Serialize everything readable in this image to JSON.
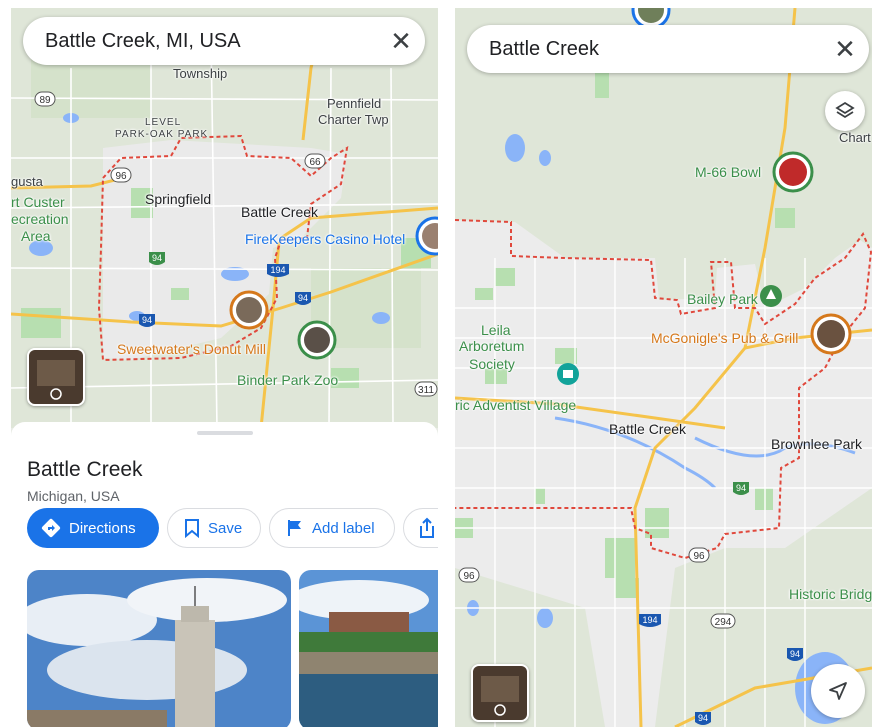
{
  "left": {
    "search": {
      "text": "Battle Creek, MI, USA",
      "clear_icon": "close-icon"
    },
    "map_labels": {
      "township": "Township",
      "level": "LEVEL",
      "park_oak_park": "PARK-OAK PARK",
      "pennfield": "Pennfield",
      "charter_twp": "Charter Twp",
      "gusta": "gusta",
      "fort_custer": "rt Custer",
      "recreation": "ecreation",
      "area": "Area",
      "springfield": "Springfield",
      "battle_creek": "Battle Creek",
      "firekeepers": "FireKeepers Casino Hotel",
      "sweetwater": "Sweetwater's Donut Mill",
      "binder_park": "Binder Park Zoo"
    },
    "route_shields": [
      "89",
      "96",
      "66",
      "94",
      "194",
      "94",
      "94",
      "311"
    ],
    "place": {
      "title": "Battle Creek",
      "subtitle": "Michigan, USA",
      "actions": {
        "directions": "Directions",
        "save": "Save",
        "add_label": "Add label"
      }
    }
  },
  "right": {
    "search": {
      "text": "Battle Creek",
      "clear_icon": "close-icon"
    },
    "map_labels": {
      "m66_bowl": "M-66 Bowl",
      "chart_partial": "Chart",
      "bailey_park": "Bailey Park",
      "mcgonigles": "McGonigle's Pub & Grill",
      "leila": "Leila",
      "arboretum": "Arboretum",
      "society": "Society",
      "adventist": "ric Adventist Village",
      "battle_creek": "Battle Creek",
      "brownlee": "Brownlee Park",
      "historic": "Historic Bridg"
    },
    "route_shields": [
      "94",
      "96",
      "96",
      "194",
      "294",
      "94",
      "94"
    ]
  },
  "colors": {
    "accent": "#1a73e8",
    "boundary": "#e0483c",
    "poi_orange": "#d5781b",
    "poi_green": "#3b8f4a",
    "highway": "#f5c34a",
    "water": "#8ab4f8",
    "park": "#b7dfb0"
  }
}
